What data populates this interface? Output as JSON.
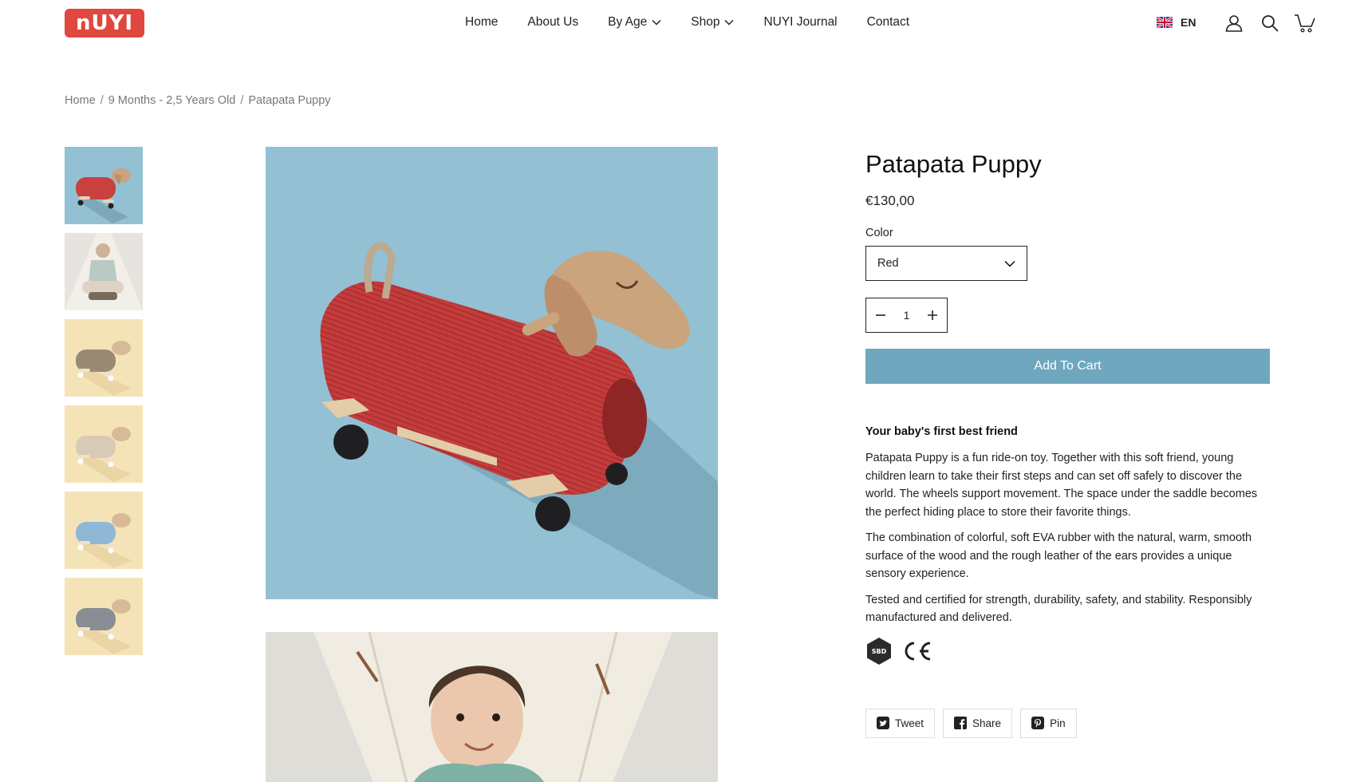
{
  "header": {
    "logo_text": "nUYI",
    "brand_color": "#e0473e",
    "nav": [
      {
        "label": "Home",
        "has_dropdown": false
      },
      {
        "label": "About Us",
        "has_dropdown": false
      },
      {
        "label": "By Age",
        "has_dropdown": true
      },
      {
        "label": "Shop",
        "has_dropdown": true
      },
      {
        "label": "NUYI Journal",
        "has_dropdown": false
      },
      {
        "label": "Contact",
        "has_dropdown": false
      }
    ],
    "language": "EN",
    "icons": [
      "uk-flag-icon",
      "account-icon",
      "search-icon",
      "cart-icon"
    ]
  },
  "breadcrumb": [
    "Home",
    "9 Months - 2,5 Years Old",
    "Patapata Puppy"
  ],
  "product": {
    "title": "Patapata Puppy",
    "price": "€130,00",
    "color_label": "Color",
    "color_selected": "Red",
    "quantity": "1",
    "add_to_cart": "Add To Cart",
    "accent_color": "#6fa7bf",
    "description_heading": "Your baby's first best friend",
    "description": [
      "Patapata Puppy is a fun ride-on toy. Together with this soft friend, young children learn to take their first steps and can set off safely to discover the world. The wheels support movement. The space under the saddle becomes the perfect hiding place to store their favorite things.",
      "The combination of colorful, soft EVA rubber with the natural, warm, smooth surface of the wood and the rough leather of the ears provides a unique sensory experience.",
      "Tested and certified for strength, durability, safety, and stability. Responsibly manufactured and delivered."
    ],
    "cert_sbd": "SBD",
    "cert_ce": "CE"
  },
  "thumbnails": [
    {
      "variant": "red",
      "color": "#c94040",
      "bg": "#93c0d3"
    },
    {
      "variant": "lifestyle",
      "color": "#b9c9c4",
      "bg": "#e6e4df"
    },
    {
      "variant": "brown",
      "color": "#9a8a74",
      "bg": "#f5e3b8"
    },
    {
      "variant": "beige",
      "color": "#d8cbb5",
      "bg": "#f5e3b8"
    },
    {
      "variant": "blue",
      "color": "#8fb8d6",
      "bg": "#f5e3b8"
    },
    {
      "variant": "grey",
      "color": "#8a8d93",
      "bg": "#f5e3b8"
    }
  ],
  "share": [
    {
      "label": "Tweet",
      "icon": "twitter-icon"
    },
    {
      "label": "Share",
      "icon": "facebook-icon"
    },
    {
      "label": "Pin",
      "icon": "pinterest-icon"
    }
  ]
}
